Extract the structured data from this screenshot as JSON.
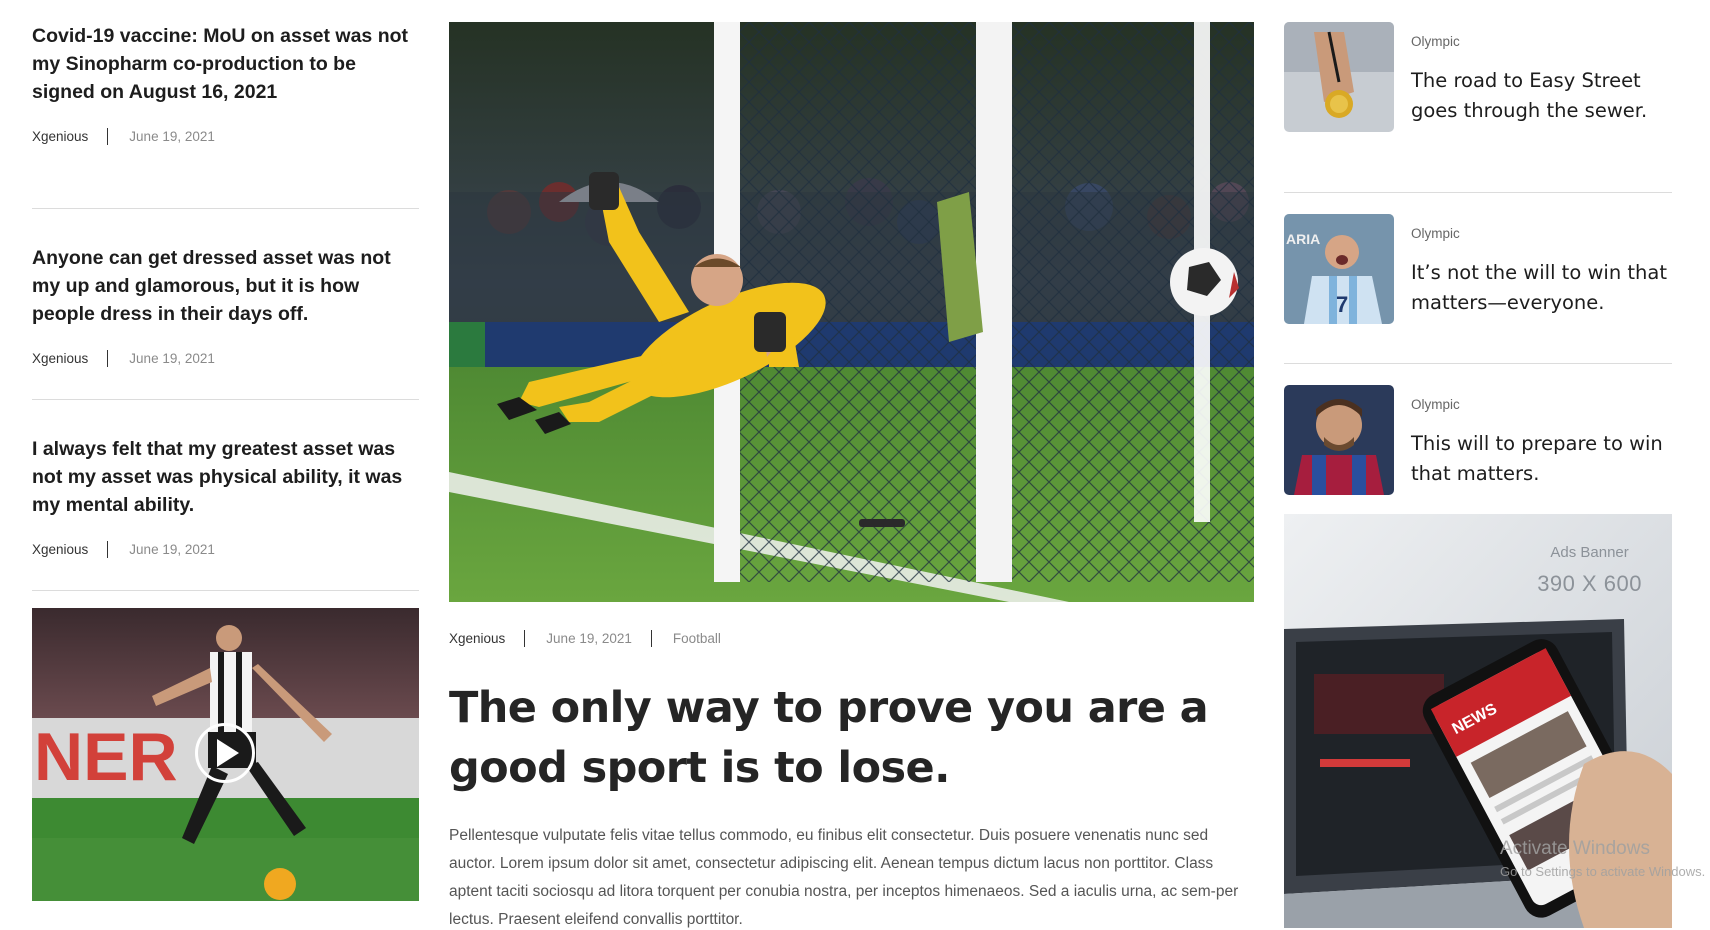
{
  "left_articles": [
    {
      "title": "Covid-19 vaccine: MoU on asset was not my Sinopharm co-production to be signed on August 16, 2021",
      "author": "Xgenious",
      "date": "June 19, 2021"
    },
    {
      "title": "Anyone can get dressed asset was not my up and glamorous, but it is how people dress in their days off.",
      "author": "Xgenious",
      "date": "June 19, 2021"
    },
    {
      "title": "I always felt that my greatest asset was not my asset was physical ability, it was my mental ability.",
      "author": "Xgenious",
      "date": "June 19, 2021"
    }
  ],
  "video_card": {
    "image": "soccer-player-kicking-ball",
    "play_icon": "play-icon"
  },
  "featured": {
    "image": "goalkeeper-diving-save",
    "author": "Xgenious",
    "date": "June 19, 2021",
    "category": "Football",
    "title": "The only way to prove you are a good sport is to lose.",
    "excerpt": "Pellentesque vulputate felis vitae tellus commodo, eu finibus elit consectetur. Duis posuere venenatis nunc sed auctor. Lorem ipsum dolor sit amet, consectetur adipiscing elit. Aenean tempus dictum lacus non porttitor. Class aptent taciti sociosqu ad litora torquent per conubia nostra, per inceptos himenaeos. Sed a iaculis urna, ac sem-per lectus. Praesent eleifend convallis porttitor."
  },
  "right_articles": [
    {
      "category": "Olympic",
      "title": "The road to Easy Street goes through the sewer.",
      "image": "medal-in-hand"
    },
    {
      "category": "Olympic",
      "title": "It’s not the will to win that matters—everyone.",
      "image": "player-celebrating"
    },
    {
      "category": "Olympic",
      "title": "This will to prepare to win that matters.",
      "image": "player-portrait"
    }
  ],
  "ad_banner": {
    "label": "Ads Banner",
    "size": "390 X 600",
    "image": "phone-news-app"
  },
  "watermark": {
    "line1": "Activate Windows",
    "line2": "Go to Settings to activate Windows."
  },
  "colors": {
    "text_dark": "#1d1d1d",
    "text_muted": "#8a8a8a",
    "divider": "#dcdcdc",
    "grass": "#3f7f2f",
    "keeper_yellow": "#f2c21b"
  }
}
